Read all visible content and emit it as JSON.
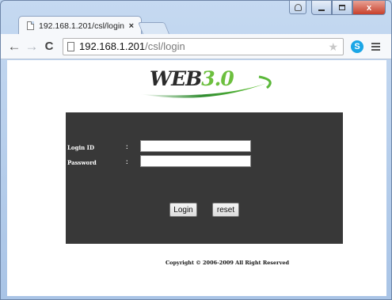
{
  "browser": {
    "tab_title": "192.168.1.201/csl/login",
    "tab_close": "×",
    "url_host": "192.168.1.201",
    "url_path": "/csl/login",
    "skype_letter": "S",
    "caption": {
      "close": "x"
    }
  },
  "icons": {
    "back": "←",
    "forward": "→",
    "reload": "C",
    "star": "★"
  },
  "logo": {
    "text_before": "WEB",
    "text_accent": "3.0"
  },
  "login": {
    "id_label": "Login ID",
    "password_label": "Password",
    "colon": ":",
    "id_value": "",
    "password_value": "",
    "login_button": "Login",
    "reset_button": "reset"
  },
  "footer": {
    "copyright": "Copyright © 2006-2009 All Right Reserved"
  }
}
